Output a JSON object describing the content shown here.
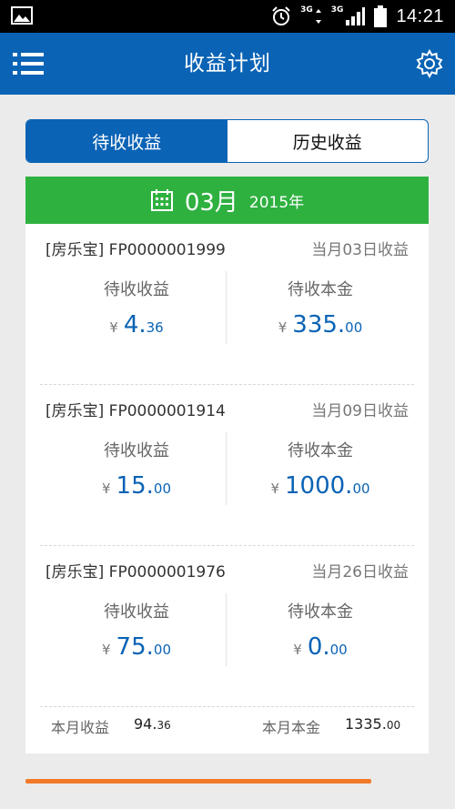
{
  "status_bar": {
    "network_1": "3G",
    "network_2": "3G",
    "time": "14:21"
  },
  "app_bar": {
    "title": "收益计划"
  },
  "tabs": [
    {
      "label": "待收收益",
      "active": true
    },
    {
      "label": "历史收益",
      "active": false
    }
  ],
  "month_header": {
    "month": "03月",
    "year": "2015年"
  },
  "items": [
    {
      "name": "[房乐宝] FP0000001999",
      "due": "当月03日收益",
      "income_label": "待收收益",
      "income_currency": "¥",
      "income_int": "4.",
      "income_dec": "36",
      "principal_label": "待收本金",
      "principal_currency": "¥",
      "principal_int": "335.",
      "principal_dec": "00"
    },
    {
      "name": "[房乐宝] FP0000001914",
      "due": "当月09日收益",
      "income_label": "待收收益",
      "income_currency": "¥",
      "income_int": "15.",
      "income_dec": "00",
      "principal_label": "待收本金",
      "principal_currency": "¥",
      "principal_int": "1000.",
      "principal_dec": "00"
    },
    {
      "name": "[房乐宝] FP0000001976",
      "due": "当月26日收益",
      "income_label": "待收收益",
      "income_currency": "¥",
      "income_int": "75.",
      "income_dec": "00",
      "principal_label": "待收本金",
      "principal_currency": "¥",
      "principal_int": "0.",
      "principal_dec": "00"
    }
  ],
  "summary": {
    "income_label": "本月收益",
    "income_int": "94.",
    "income_dec": "36",
    "principal_label": "本月本金",
    "principal_int": "1335.",
    "principal_dec": "00"
  },
  "colors": {
    "primary": "#0a63b5",
    "month_green": "#2fb140",
    "accent_orange": "#f07a2a"
  },
  "icons": [
    "image-icon",
    "alarm-icon",
    "signal-icon",
    "battery-icon",
    "menu-icon",
    "gear-icon",
    "calendar-icon"
  ]
}
